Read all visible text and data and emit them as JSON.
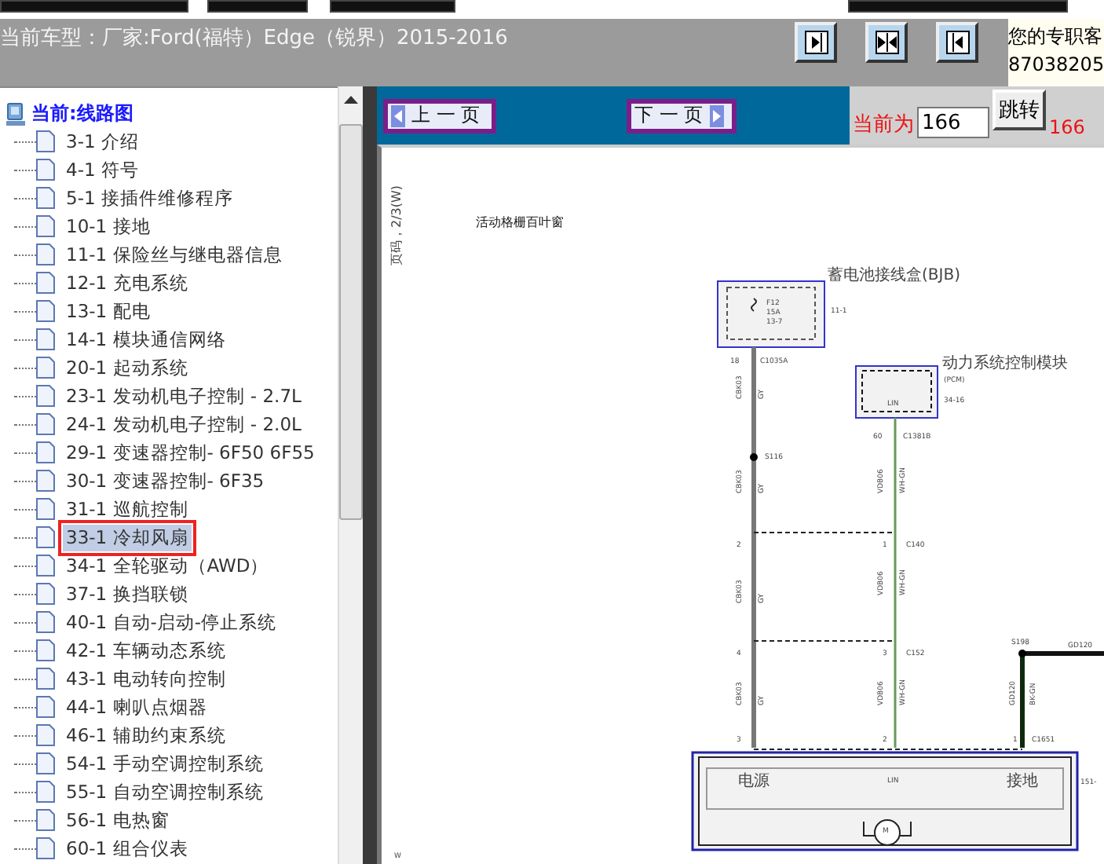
{
  "header": {
    "vehicle": "当前车型：厂家:Ford(福特）Edge（锐界）2015-2016",
    "layout_buttons": [
      {
        "kind": "right"
      },
      {
        "kind": "both"
      },
      {
        "kind": "left"
      }
    ],
    "contact": [
      "您的专职客",
      "87038205"
    ]
  },
  "tree": {
    "root": "当前:线路图",
    "items": [
      {
        "label": "3-1 介绍",
        "selected": false
      },
      {
        "label": "4-1 符号",
        "selected": false
      },
      {
        "label": "5-1 接插件维修程序",
        "selected": false
      },
      {
        "label": "10-1 接地",
        "selected": false
      },
      {
        "label": "11-1 保险丝与继电器信息",
        "selected": false
      },
      {
        "label": "12-1 充电系统",
        "selected": false
      },
      {
        "label": "13-1 配电",
        "selected": false
      },
      {
        "label": "14-1 模块通信网络",
        "selected": false
      },
      {
        "label": "20-1 起动系统",
        "selected": false
      },
      {
        "label": "23-1 发动机电子控制 - 2.7L",
        "selected": false
      },
      {
        "label": "24-1 发动机电子控制 - 2.0L",
        "selected": false
      },
      {
        "label": "29-1 变速器控制- 6F50 6F55",
        "selected": false
      },
      {
        "label": "30-1 变速器控制- 6F35",
        "selected": false
      },
      {
        "label": "31-1 巡航控制",
        "selected": false
      },
      {
        "label": "33-1 冷却风扇",
        "selected": true
      },
      {
        "label": "34-1 全轮驱动（AWD）",
        "selected": false
      },
      {
        "label": "37-1 换挡联锁",
        "selected": false
      },
      {
        "label": "40-1 自动-启动-停止系统",
        "selected": false
      },
      {
        "label": "42-1 车辆动态系统",
        "selected": false
      },
      {
        "label": "43-1 电动转向控制",
        "selected": false
      },
      {
        "label": "44-1 喇叭点烟器",
        "selected": false
      },
      {
        "label": "46-1 辅助约束系统",
        "selected": false
      },
      {
        "label": "54-1 手动空调控制系统",
        "selected": false
      },
      {
        "label": "55-1 自动空调控制系统",
        "selected": false
      },
      {
        "label": "56-1 电热窗",
        "selected": false
      },
      {
        "label": "60-1 组合仪表",
        "selected": false
      }
    ]
  },
  "nav": {
    "prev": "上 一 页",
    "next": "下 一 页",
    "page_label": "当前为",
    "page_value": "166",
    "go": "跳转",
    "total": "166"
  },
  "diagram": {
    "page_ref": "页码，2/3(W)",
    "title": "活动格栅百叶窗",
    "footer": "W",
    "labels": [
      "蓄电池接线盒(BJB)",
      "F12",
      "15A",
      "13-7",
      "11-1",
      "18",
      "C1035A",
      "动力系统控制模块",
      "(PCM)",
      "LIN",
      "34-16",
      "60",
      "C1381B",
      "S116",
      "2",
      "1",
      "C140",
      "4",
      "3",
      "C152",
      "S198",
      "GD120",
      "3",
      "2",
      "1",
      "C1651",
      "电源",
      "LIN",
      "接地",
      "M",
      "151-"
    ],
    "wire_labels": [
      "CBK03",
      "GY",
      "CBK03",
      "GY",
      "CBK03",
      "GY",
      "CBK03",
      "GY",
      "VDB06",
      "WH-GN",
      "VDB06",
      "WH-GN",
      "VDB06",
      "WH-GN",
      "GD120",
      "BK-GN"
    ]
  }
}
